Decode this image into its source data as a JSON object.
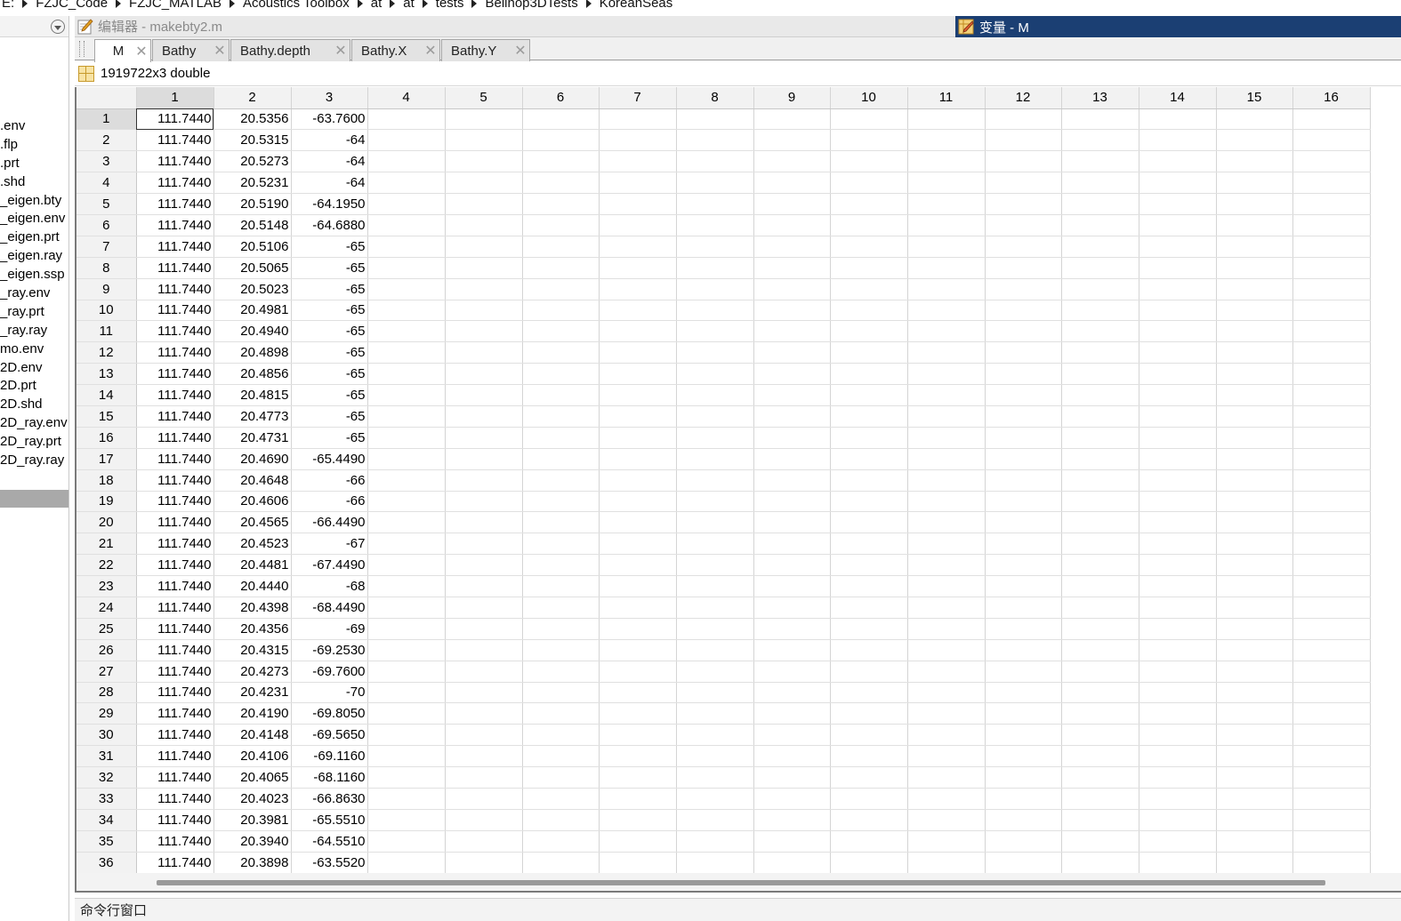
{
  "breadcrumb": {
    "items": [
      "E:",
      "FZJC_Code",
      "FZJC_MATLAB",
      "Acoustics Toolbox",
      "at",
      "at",
      "tests",
      "Bellhop3DTests",
      "KoreanSeas"
    ]
  },
  "file_panel": {
    "files": [
      ".env",
      ".flp",
      ".prt",
      ".shd",
      "_eigen.bty",
      "_eigen.env",
      "_eigen.prt",
      "_eigen.ray",
      "_eigen.ssp",
      "_ray.env",
      "_ray.prt",
      "_ray.ray",
      "mo.env",
      "2D.env",
      "2D.prt",
      "2D.shd",
      "2D_ray.env",
      "2D_ray.prt",
      "2D_ray.ray"
    ]
  },
  "editor": {
    "title": "编辑器 - makebty2.m",
    "icon": "pencil-icon"
  },
  "variables": {
    "title": "变量 - M",
    "icon": "variable-editor-icon",
    "title_bg": "#1b3f73"
  },
  "tabs": [
    {
      "label": "M",
      "active": true
    },
    {
      "label": "Bathy",
      "active": false
    },
    {
      "label": "Bathy.depth",
      "active": false
    },
    {
      "label": "Bathy.X",
      "active": false
    },
    {
      "label": "Bathy.Y",
      "active": false
    }
  ],
  "tab_close_glyph": "✕",
  "info": {
    "size_text": "1919722x3 double",
    "icon": "matrix-grid-icon"
  },
  "sheet": {
    "columns": [
      "1",
      "2",
      "3",
      "4",
      "5",
      "6",
      "7",
      "8",
      "9",
      "10",
      "11",
      "12",
      "13",
      "14",
      "15",
      "16"
    ],
    "selected_row": "1",
    "selected_col": "1",
    "rows": [
      {
        "n": "1",
        "c": [
          "111.7440",
          "20.5356",
          "-63.7600"
        ]
      },
      {
        "n": "2",
        "c": [
          "111.7440",
          "20.5315",
          "-64"
        ]
      },
      {
        "n": "3",
        "c": [
          "111.7440",
          "20.5273",
          "-64"
        ]
      },
      {
        "n": "4",
        "c": [
          "111.7440",
          "20.5231",
          "-64"
        ]
      },
      {
        "n": "5",
        "c": [
          "111.7440",
          "20.5190",
          "-64.1950"
        ]
      },
      {
        "n": "6",
        "c": [
          "111.7440",
          "20.5148",
          "-64.6880"
        ]
      },
      {
        "n": "7",
        "c": [
          "111.7440",
          "20.5106",
          "-65"
        ]
      },
      {
        "n": "8",
        "c": [
          "111.7440",
          "20.5065",
          "-65"
        ]
      },
      {
        "n": "9",
        "c": [
          "111.7440",
          "20.5023",
          "-65"
        ]
      },
      {
        "n": "10",
        "c": [
          "111.7440",
          "20.4981",
          "-65"
        ]
      },
      {
        "n": "11",
        "c": [
          "111.7440",
          "20.4940",
          "-65"
        ]
      },
      {
        "n": "12",
        "c": [
          "111.7440",
          "20.4898",
          "-65"
        ]
      },
      {
        "n": "13",
        "c": [
          "111.7440",
          "20.4856",
          "-65"
        ]
      },
      {
        "n": "14",
        "c": [
          "111.7440",
          "20.4815",
          "-65"
        ]
      },
      {
        "n": "15",
        "c": [
          "111.7440",
          "20.4773",
          "-65"
        ]
      },
      {
        "n": "16",
        "c": [
          "111.7440",
          "20.4731",
          "-65"
        ]
      },
      {
        "n": "17",
        "c": [
          "111.7440",
          "20.4690",
          "-65.4490"
        ]
      },
      {
        "n": "18",
        "c": [
          "111.7440",
          "20.4648",
          "-66"
        ]
      },
      {
        "n": "19",
        "c": [
          "111.7440",
          "20.4606",
          "-66"
        ]
      },
      {
        "n": "20",
        "c": [
          "111.7440",
          "20.4565",
          "-66.4490"
        ]
      },
      {
        "n": "21",
        "c": [
          "111.7440",
          "20.4523",
          "-67"
        ]
      },
      {
        "n": "22",
        "c": [
          "111.7440",
          "20.4481",
          "-67.4490"
        ]
      },
      {
        "n": "23",
        "c": [
          "111.7440",
          "20.4440",
          "-68"
        ]
      },
      {
        "n": "24",
        "c": [
          "111.7440",
          "20.4398",
          "-68.4490"
        ]
      },
      {
        "n": "25",
        "c": [
          "111.7440",
          "20.4356",
          "-69"
        ]
      },
      {
        "n": "26",
        "c": [
          "111.7440",
          "20.4315",
          "-69.2530"
        ]
      },
      {
        "n": "27",
        "c": [
          "111.7440",
          "20.4273",
          "-69.7600"
        ]
      },
      {
        "n": "28",
        "c": [
          "111.7440",
          "20.4231",
          "-70"
        ]
      },
      {
        "n": "29",
        "c": [
          "111.7440",
          "20.4190",
          "-69.8050"
        ]
      },
      {
        "n": "30",
        "c": [
          "111.7440",
          "20.4148",
          "-69.5650"
        ]
      },
      {
        "n": "31",
        "c": [
          "111.7440",
          "20.4106",
          "-69.1160"
        ]
      },
      {
        "n": "32",
        "c": [
          "111.7440",
          "20.4065",
          "-68.1160"
        ]
      },
      {
        "n": "33",
        "c": [
          "111.7440",
          "20.4023",
          "-66.8630"
        ]
      },
      {
        "n": "34",
        "c": [
          "111.7440",
          "20.3981",
          "-65.5510"
        ]
      },
      {
        "n": "35",
        "c": [
          "111.7440",
          "20.3940",
          "-64.5510"
        ]
      },
      {
        "n": "36",
        "c": [
          "111.7440",
          "20.3898",
          "-63.5520"
        ]
      }
    ]
  },
  "command_window": {
    "title": "命令行窗口"
  }
}
